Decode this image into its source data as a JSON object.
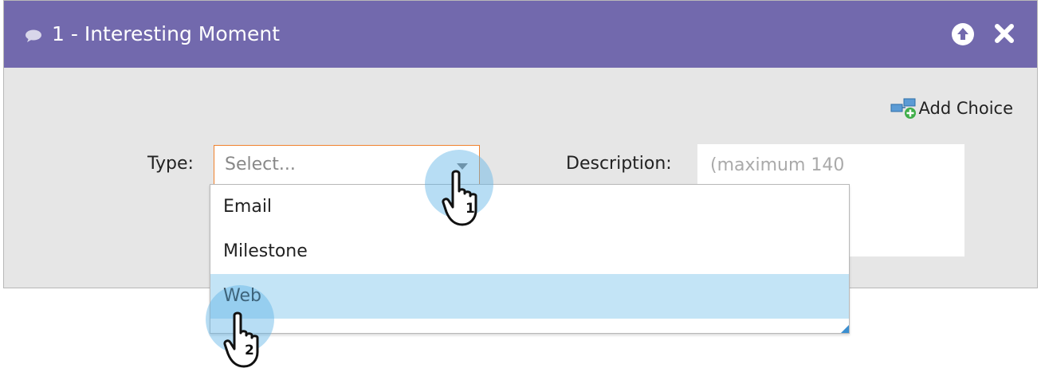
{
  "dialog": {
    "title": "1 - Interesting Moment",
    "header_color": "#7269ad",
    "icons": [
      "chat-bubble-icon",
      "arrow-up-circle-icon",
      "close-icon"
    ]
  },
  "add_choice": {
    "label": "Add Choice",
    "icon": "add-choice-icon"
  },
  "type_field": {
    "label": "Type:",
    "placeholder": "Select...",
    "accent_color": "#f0822e"
  },
  "description_field": {
    "label": "Description:",
    "placeholder": "(maximum 140"
  },
  "dropdown": {
    "options": [
      "Email",
      "Milestone",
      "Web"
    ],
    "highlighted": "Web",
    "highlight_color": "#c3e4f6"
  },
  "callouts": [
    {
      "step": "1"
    },
    {
      "step": "2"
    }
  ]
}
